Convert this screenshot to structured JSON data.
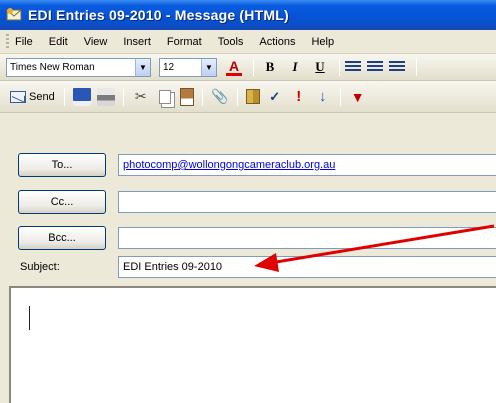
{
  "window": {
    "title": "EDI Entries 09-2010 - Message (HTML)",
    "icon": "envelope-app-icon"
  },
  "menubar": {
    "items": [
      {
        "label": "File"
      },
      {
        "label": "Edit"
      },
      {
        "label": "View"
      },
      {
        "label": "Insert"
      },
      {
        "label": "Format"
      },
      {
        "label": "Tools"
      },
      {
        "label": "Actions"
      },
      {
        "label": "Help"
      }
    ]
  },
  "format_toolbar": {
    "font": "Times New Roman",
    "size": "12",
    "bold": "B",
    "italic": "I",
    "underline": "U",
    "font_color_glyph": "A"
  },
  "standard_toolbar": {
    "send_label": "Send"
  },
  "headers": {
    "to_button": "To...",
    "to_value": "photocomp@wollongongcameraclub.org.au",
    "cc_button": "Cc...",
    "cc_value": "",
    "bcc_button": "Bcc...",
    "bcc_value": "",
    "subject_label": "Subject:",
    "subject_value": "EDI Entries 09-2010"
  },
  "colors": {
    "titlebar": "#0553d6",
    "link": "#0000ee",
    "annotation_arrow": "#e00000"
  },
  "body": {
    "text": ""
  }
}
